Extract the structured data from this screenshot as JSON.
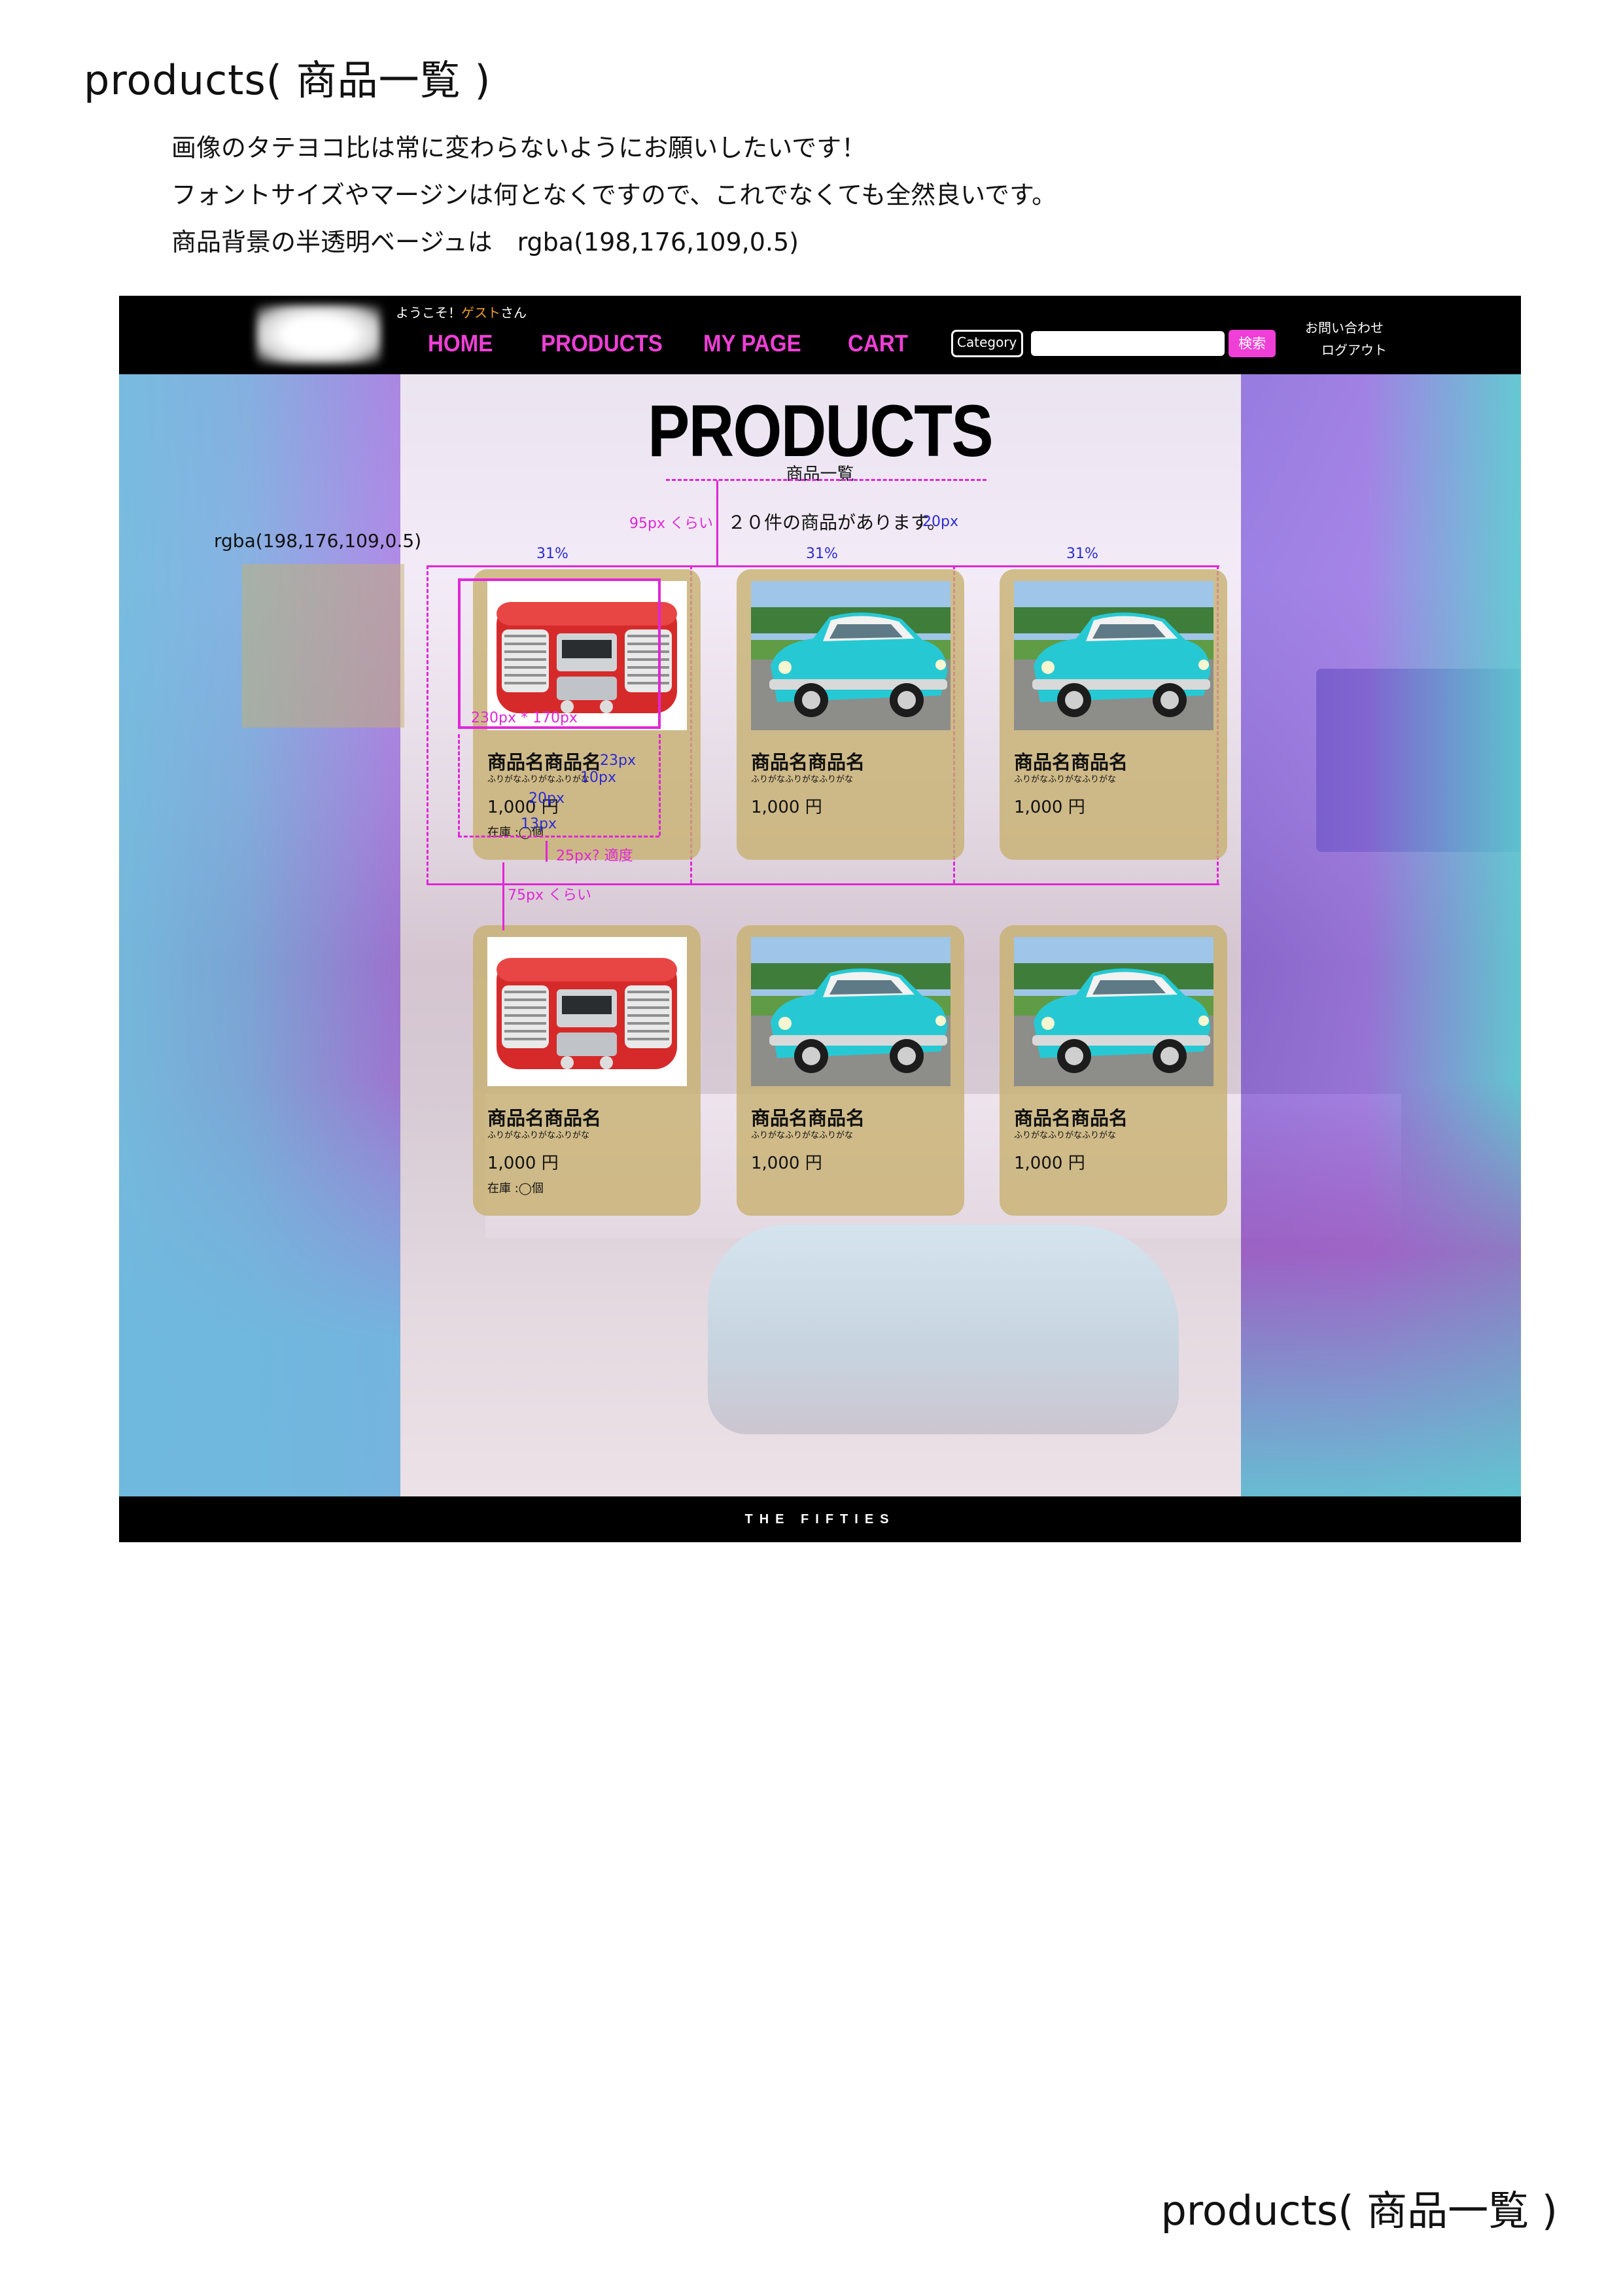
{
  "doc": {
    "title": "products( 商品一覧 )",
    "notes": [
      "画像のタテヨコ比は常に変わらないようにお願いしたいです！",
      "フォントサイズやマージンは何となくですので、これでなくても全然良いです。",
      "商品背景の半透明ベージュは　rgba(198,176,109,0.5)"
    ],
    "footer_title": "products( 商品一覧 )"
  },
  "header": {
    "welcome_prefix": "ようこそ！",
    "welcome_guest": "ゲスト",
    "welcome_suffix": "さん",
    "nav": [
      "HOME",
      "PRODUCTS",
      "MY PAGE",
      "CART"
    ],
    "category_label": "Category",
    "search_value": "",
    "search_button": "検索",
    "links": [
      "お問い合わせ",
      "ログアウト"
    ]
  },
  "main": {
    "title": "PRODUCTS",
    "subtitle": "商品一覧",
    "count_text": "２０件の商品があります。",
    "sample_label": "rgba(198,176,109,0.5)"
  },
  "annotations": {
    "gap_95": "95px くらい",
    "gap_20": "20px",
    "col_width": "31%",
    "img_size": "230px * 170px",
    "px23": "23px",
    "px10": "10px",
    "px20": "20px",
    "px13": "13px",
    "card_gap": "25px? 適度",
    "row_gap": "75px くらい"
  },
  "products": [
    {
      "name": "商品名商品名",
      "furigana": "ふりがなふりがなふりがな",
      "price": "1,000 円",
      "stock": "在庫 :◯個",
      "image": "red-radio"
    },
    {
      "name": "商品名商品名",
      "furigana": "ふりがなふりがなふりがな",
      "price": "1,000 円",
      "stock": "",
      "image": "turquoise-classic-car"
    },
    {
      "name": "商品名商品名",
      "furigana": "ふりがなふりがなふりがな",
      "price": "1,000 円",
      "stock": "",
      "image": "turquoise-classic-car"
    },
    {
      "name": "商品名商品名",
      "furigana": "ふりがなふりがなふりがな",
      "price": "1,000 円",
      "stock": "在庫 :◯個",
      "image": "red-radio"
    },
    {
      "name": "商品名商品名",
      "furigana": "ふりがなふりがなふりがな",
      "price": "1,000 円",
      "stock": "",
      "image": "turquoise-classic-car"
    },
    {
      "name": "商品名商品名",
      "furigana": "ふりがなふりがなふりがな",
      "price": "1,000 円",
      "stock": "",
      "image": "turquoise-classic-car"
    }
  ],
  "footer": {
    "brand": "THE FIFTIES"
  },
  "colors": {
    "accent": "#ef3fd6",
    "card_bg": "rgba(198,176,109,0.5)",
    "annotation": "#e027d8",
    "annotation_blue": "#2b2bd3"
  }
}
